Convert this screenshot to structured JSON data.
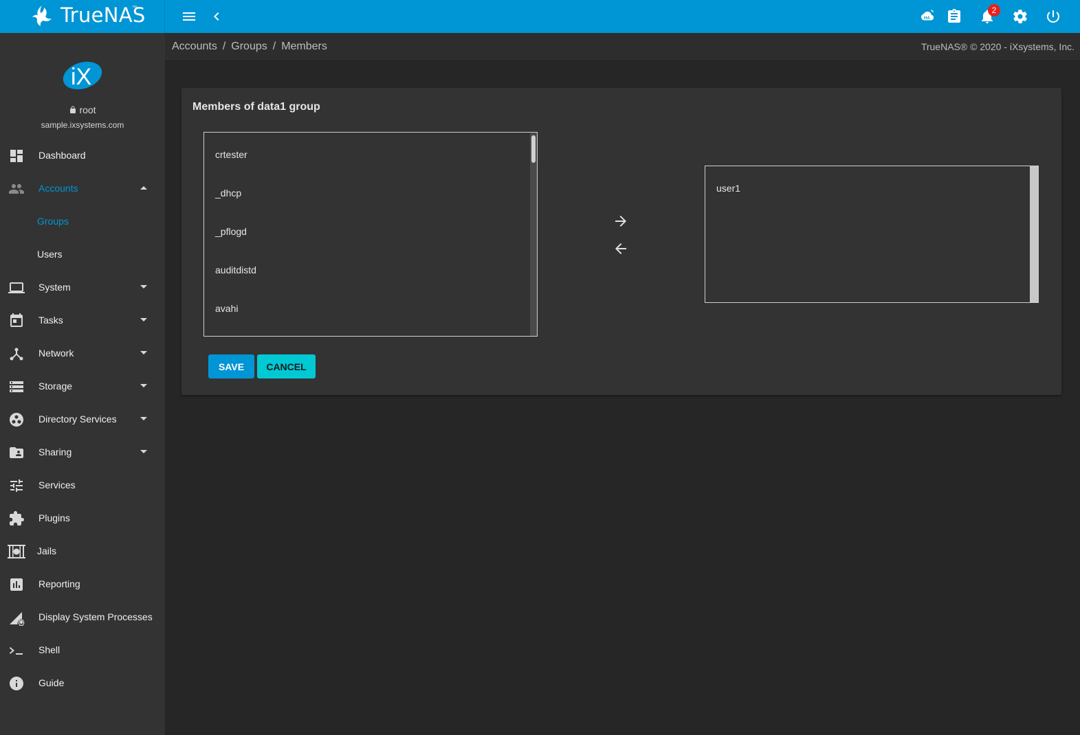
{
  "app": {
    "brand": "TrueNAS",
    "trademark": "™"
  },
  "topbar": {
    "notification_count": "2",
    "icons": [
      "menu-icon",
      "back-icon",
      "ha-status-icon",
      "task-manager-icon",
      "notifications-icon",
      "settings-icon",
      "power-icon"
    ]
  },
  "user": {
    "name": "root",
    "host": "sample.ixsystems.com"
  },
  "sidebar": {
    "items": [
      {
        "label": "Dashboard",
        "icon": "dashboard-icon"
      },
      {
        "label": "Accounts",
        "icon": "accounts-icon"
      },
      {
        "label": "Groups"
      },
      {
        "label": "Users"
      },
      {
        "label": "System",
        "icon": "system-icon"
      },
      {
        "label": "Tasks",
        "icon": "tasks-icon"
      },
      {
        "label": "Network",
        "icon": "network-icon"
      },
      {
        "label": "Storage",
        "icon": "storage-icon"
      },
      {
        "label": "Directory Services",
        "icon": "directory-services-icon"
      },
      {
        "label": "Sharing",
        "icon": "sharing-icon"
      },
      {
        "label": "Services",
        "icon": "services-icon"
      },
      {
        "label": "Plugins",
        "icon": "plugins-icon"
      },
      {
        "label": "Jails",
        "icon": "jails-icon"
      },
      {
        "label": "Reporting",
        "icon": "reporting-icon"
      },
      {
        "label": "Display System Processes",
        "icon": "processes-icon"
      },
      {
        "label": "Shell",
        "icon": "shell-icon"
      },
      {
        "label": "Guide",
        "icon": "guide-icon"
      }
    ]
  },
  "breadcrumb": {
    "items": [
      "Accounts",
      "Groups",
      "Members"
    ],
    "separator": "/"
  },
  "copyright": "TrueNAS® © 2020 - iXsystems, Inc.",
  "card": {
    "title": "Members of data1 group",
    "available_users": [
      "crtester",
      "_dhcp",
      "_pflogd",
      "auditdistd",
      "avahi"
    ],
    "selected_users": [
      "user1"
    ],
    "save_label": "SAVE",
    "cancel_label": "CANCEL"
  },
  "colors": {
    "accent": "#0095d5",
    "cancel": "#00c9d4",
    "badge": "#e8211a"
  }
}
